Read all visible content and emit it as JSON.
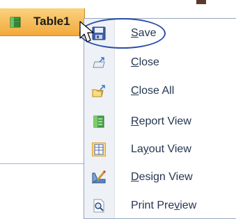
{
  "tab": {
    "label": "Table1",
    "icon": "table-icon"
  },
  "menu": {
    "items": [
      {
        "pre": "",
        "key": "S",
        "post": "ave",
        "icon": "save-icon"
      },
      {
        "pre": "",
        "key": "C",
        "post": "lose",
        "icon": "close-icon"
      },
      {
        "pre": "",
        "key": "C",
        "post": "lose All",
        "icon": "close-all-icon"
      },
      {
        "pre": "",
        "key": "R",
        "post": "eport View",
        "icon": "report-view-icon"
      },
      {
        "pre": "La",
        "key": "y",
        "post": "out View",
        "icon": "layout-view-icon"
      },
      {
        "pre": "",
        "key": "D",
        "post": "esign View",
        "icon": "design-view-icon"
      },
      {
        "pre": "Print Pre",
        "key": "v",
        "post": "iew",
        "icon": "print-preview-icon"
      }
    ]
  },
  "colors": {
    "tab_gradient_top": "#fbd27f",
    "tab_gradient_bottom": "#f2a93b",
    "menu_text": "#243652",
    "menu_gutter": "#eef1f6",
    "highlight_oval": "#2b4fa8"
  }
}
